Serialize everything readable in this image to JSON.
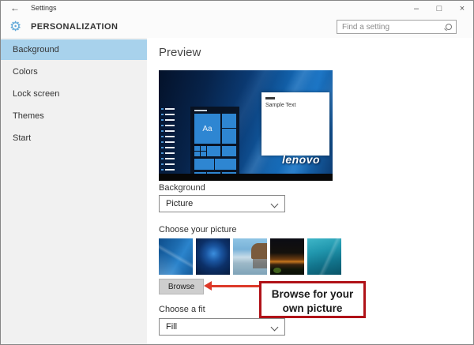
{
  "window": {
    "title": "Settings",
    "back_icon": "←",
    "controls": {
      "minimize": "–",
      "maximize": "□",
      "close": "×"
    }
  },
  "header": {
    "gear_icon": "⚙",
    "title": "PERSONALIZATION",
    "search_placeholder": "Find a setting"
  },
  "sidebar": {
    "items": [
      {
        "label": "Background",
        "selected": true
      },
      {
        "label": "Colors",
        "selected": false
      },
      {
        "label": "Lock screen",
        "selected": false
      },
      {
        "label": "Themes",
        "selected": false
      },
      {
        "label": "Start",
        "selected": false
      }
    ]
  },
  "main": {
    "preview_heading": "Preview",
    "preview": {
      "sample_text": "Sample Text",
      "logo": "lenovo",
      "tile_label": "Aa"
    },
    "background_label": "Background",
    "background_value": "Picture",
    "choose_picture_label": "Choose your picture",
    "thumbnails": [
      {
        "name": "blue-abstract-swirls"
      },
      {
        "name": "windows-hero-dark-blue"
      },
      {
        "name": "beach-rocks-reflection"
      },
      {
        "name": "night-sky-orange-glow"
      },
      {
        "name": "underwater-teal"
      }
    ],
    "browse_label": "Browse",
    "choose_fit_label": "Choose a fit",
    "fit_value": "Fill"
  },
  "callout": {
    "line1": "Browse for your",
    "line2": "own picture"
  },
  "colors": {
    "sidebar_highlight": "#a8d2ec",
    "gear_accent": "#5fa8d8",
    "callout_border": "#b01218",
    "arrow_red": "#dd3a2a",
    "tile_blue": "#2e86d2"
  }
}
